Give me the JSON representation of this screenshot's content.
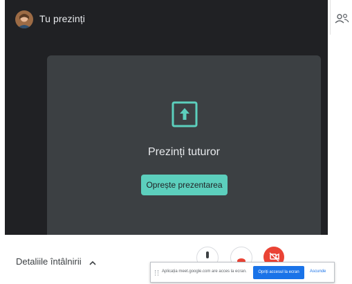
{
  "presenter": {
    "name": "Tu prezinți"
  },
  "presentation_panel": {
    "title": "Prezinți tuturor",
    "stop_button_label": "Oprește prezentarea",
    "accent_color": "#5ccfbd"
  },
  "meeting_details": {
    "label": "Detaliile întâlnirii"
  },
  "call_controls": {
    "mic_icon": "microphone-icon",
    "camera_icon": "camera-off-icon",
    "leave_icon": "camera-leave-icon",
    "leave_color": "#ea4335"
  },
  "share_notification": {
    "message": "Aplicația meet.google.com are acces la ecran.",
    "stop_sharing_label": "Opriți accesul la ecran",
    "hide_label": "Ascunde",
    "accent_color": "#1a73e8"
  },
  "people_tab": {
    "icon": "people-icon"
  }
}
